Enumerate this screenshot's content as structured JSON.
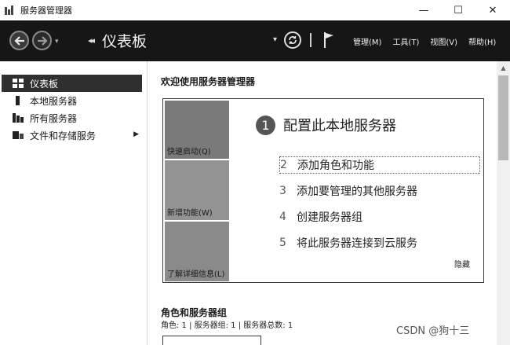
{
  "window": {
    "title": "服务器管理器",
    "controls": {
      "minimize": "—",
      "maximize": "☐",
      "close": "✕"
    }
  },
  "header": {
    "breadcrumb_arrows": "◂◂",
    "page_title": "仪表板",
    "menus": [
      {
        "label": "管理(M)"
      },
      {
        "label": "工具(T)"
      },
      {
        "label": "视图(V)"
      },
      {
        "label": "帮助(H)"
      }
    ]
  },
  "sidebar": {
    "items": [
      {
        "label": "仪表板",
        "icon": "dashboard-grid-icon",
        "active": true
      },
      {
        "label": "本地服务器",
        "icon": "server-icon",
        "active": false
      },
      {
        "label": "所有服务器",
        "icon": "servers-icon",
        "active": false
      },
      {
        "label": "文件和存储服务",
        "icon": "storage-icon",
        "active": false,
        "has_submenu": true
      }
    ]
  },
  "main": {
    "welcome_title": "欢迎使用服务器管理器",
    "tiles": [
      {
        "label": "快速启动(Q)"
      },
      {
        "label": "新增功能(W)"
      },
      {
        "label": "了解详细信息(L)"
      }
    ],
    "primary_step": {
      "number": "1",
      "label": "配置此本地服务器"
    },
    "steps": [
      {
        "number": "2",
        "label": "添加角色和功能"
      },
      {
        "number": "3",
        "label": "添加要管理的其他服务器"
      },
      {
        "number": "4",
        "label": "创建服务器组"
      },
      {
        "number": "5",
        "label": "将此服务器连接到云服务"
      }
    ],
    "hide_label": "隐藏",
    "roles_title": "角色和服务器组",
    "roles_summary": "角色: 1 | 服务器组: 1 | 服务器总数: 1"
  },
  "watermark": "CSDN @狗十三",
  "colors": {
    "header_bg": "#161616",
    "active_item_bg": "#2f2f2f",
    "tile_dark": "#7a7a7a",
    "tile_mid": "#939393"
  }
}
